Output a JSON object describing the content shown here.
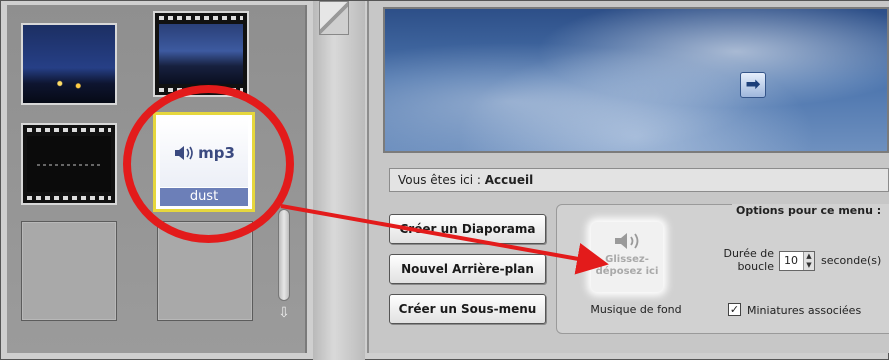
{
  "thumbnails": {
    "mp3_tile": {
      "format_label": "mp3",
      "file_name": "dust",
      "icon": "speaker-icon"
    },
    "scroll_down_icon": "down-arrow-icon"
  },
  "preview": {
    "next_icon": "right-arrow-icon",
    "next_glyph": "➡"
  },
  "breadcrumb": {
    "prefix": "Vous êtes ici : ",
    "location": "Accueil"
  },
  "buttons": {
    "create_slideshow": "Créer un Diaporama",
    "new_background": "Nouvel Arrière-plan",
    "create_submenu": "Créer un Sous-menu"
  },
  "drop_zone": {
    "text_line1": "Glissez-",
    "text_line2": "déposez ici",
    "caption": "Musique de fond"
  },
  "options": {
    "title": "Options pour ce menu :",
    "duration_label_line1": "Durée de",
    "duration_label_line2": "boucle",
    "duration_value": "10",
    "duration_unit": "seconde(s)",
    "thumbnails_checkbox_label": "Miniatures associées",
    "thumbnails_checked": true
  },
  "annotation": {
    "highlight_color": "#e31b1b"
  }
}
